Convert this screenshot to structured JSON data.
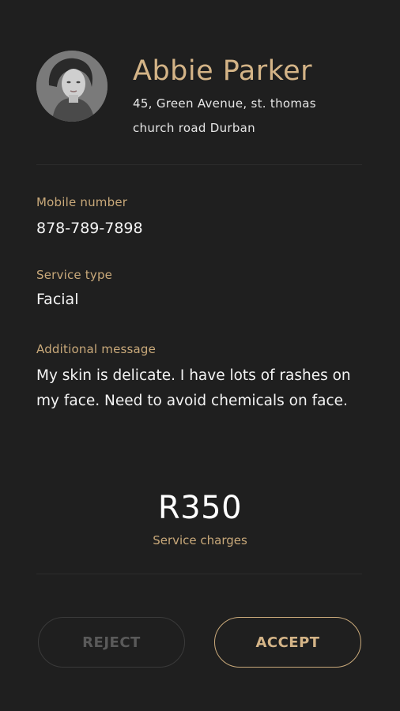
{
  "profile": {
    "name": "Abbie Parker",
    "address": "45, Green Avenue, st. thomas church road Durban"
  },
  "mobile": {
    "label": "Mobile number",
    "value": "878-789-7898"
  },
  "service": {
    "label": "Service type",
    "value": "Facial"
  },
  "message": {
    "label": "Additional message",
    "value": "My skin is delicate. I have lots of rashes on my face. Need to avoid chemicals on face."
  },
  "charges": {
    "amount": "R350",
    "label": "Service charges"
  },
  "actions": {
    "reject_label": "REJECT",
    "accept_label": "ACCEPT"
  },
  "colors": {
    "background": "#1f1f1f",
    "accent": "#d4b487",
    "reject_disabled": "#5a5a5a"
  }
}
